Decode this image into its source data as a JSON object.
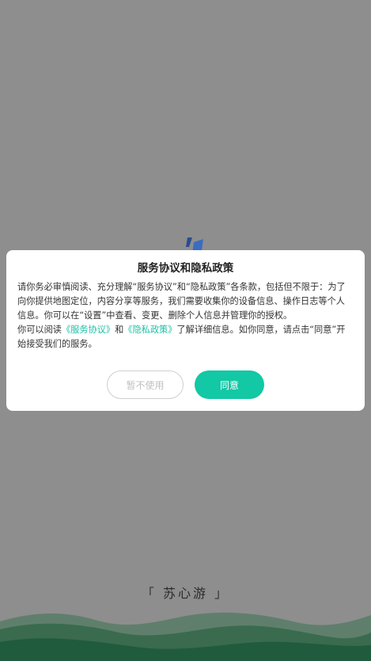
{
  "modal": {
    "title": "服务协议和隐私政策",
    "para1": "请你务必审慎阅读、充分理解“服务协议”和“隐私政策”各条款，包括但不限于：为了向你提供地图定位，内容分享等服务，我们需要收集你的设备信息、操作日志等个人信息。你可以在“设置”中查看、变更、删除个人信息并管理你的授权。",
    "para2_prefix": "你可以阅读",
    "service_link": "《服务协议》",
    "and": "和",
    "privacy_link": "《隐私政策》",
    "para2_suffix": "了解详细信息。如你同意，请点击“同意”开始接受我们的服务。",
    "decline_label": "暂不使用",
    "agree_label": "同意"
  },
  "brand": {
    "open": "「",
    "name": "苏心游",
    "close": "」"
  },
  "colors": {
    "accent": "#12c8a5",
    "link": "#19c2a6",
    "overlay": "#8e8e8e",
    "wave_dark": "#1f5b3c"
  }
}
